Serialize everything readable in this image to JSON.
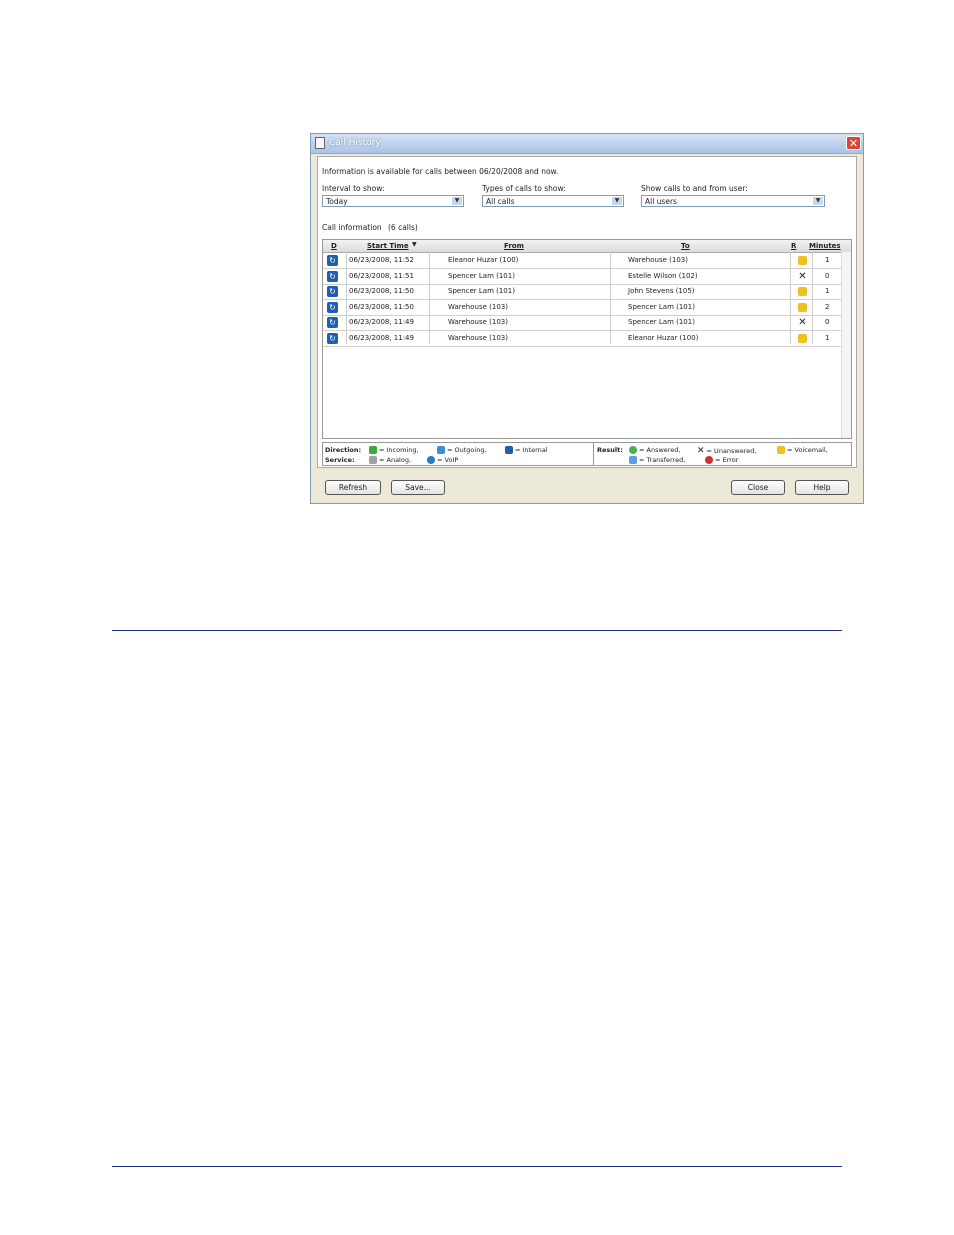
{
  "window": {
    "title": "Call History"
  },
  "info_text": "Information is available for calls between 06/20/2008 and now.",
  "filters": {
    "interval_label": "Interval to show:",
    "interval_value": "Today",
    "types_label": "Types of calls to show:",
    "types_value": "All calls",
    "user_label": "Show calls to and from user:",
    "user_value": "All users"
  },
  "call_info": {
    "label": "Call information",
    "count": "(6 calls)"
  },
  "columns": {
    "d": "D",
    "start": "Start Time",
    "from": "From",
    "to": "To",
    "r": "R",
    "minutes": "Minutes"
  },
  "rows": [
    {
      "start": "06/23/2008, 11:52",
      "from": "Eleanor Huzar (100)",
      "to": "Warehouse (103)",
      "result": "voicemail-icon",
      "minutes": "1"
    },
    {
      "start": "06/23/2008, 11:51",
      "from": "Spencer Lam (101)",
      "to": "Estelle Wilson (102)",
      "result": "unanswered-icon",
      "minutes": "0"
    },
    {
      "start": "06/23/2008, 11:50",
      "from": "Spencer Lam (101)",
      "to": "John Stevens (105)",
      "result": "voicemail-icon",
      "minutes": "1"
    },
    {
      "start": "06/23/2008, 11:50",
      "from": "Warehouse (103)",
      "to": "Spencer Lam (101)",
      "result": "voicemail-icon",
      "minutes": "2"
    },
    {
      "start": "06/23/2008, 11:49",
      "from": "Warehouse (103)",
      "to": "Spencer Lam (101)",
      "result": "unanswered-icon",
      "minutes": "0"
    },
    {
      "start": "06/23/2008, 11:49",
      "from": "Warehouse (103)",
      "to": "Eleanor Huzar (100)",
      "result": "voicemail-icon",
      "minutes": "1"
    }
  ],
  "legend": {
    "direction_label": "Direction:",
    "incoming": "= Incoming,",
    "outgoing": "= Outgoing,",
    "internal": "= Internal",
    "service_label": "Service:",
    "analog": "= Analog,",
    "voip": "= VoIP",
    "result_label": "Result:",
    "answered": "= Answered,",
    "unanswered": "= Unanswered,",
    "voicemail": "= Voicemail,",
    "transferred": "= Transferred,",
    "error": "= Error"
  },
  "buttons": {
    "refresh": "Refresh",
    "save": "Save...",
    "close": "Close",
    "help": "Help"
  },
  "colors": {
    "internal_icon": "#1e5fae",
    "rule": "#1a2b8c",
    "voicemail": "#f0c020"
  }
}
